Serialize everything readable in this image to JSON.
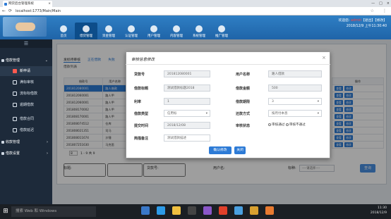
{
  "browser": {
    "tab_title": "网贷后台管理系统",
    "tab_close": "×",
    "url": "localhost:1773/Main/Main",
    "minimize": "—",
    "maximize": "□",
    "close": "×"
  },
  "header": {
    "nav": [
      "首页",
      "借贷管理",
      "资金管理",
      "认证管理",
      "用户管理",
      "内容管理",
      "系统管理",
      "推广管理"
    ],
    "welcome_prefix": "欢迎您: ",
    "user": "admin",
    "welcome_suffix": "【退出】【修改】",
    "datetime": "2018/12/9 上午11:30:40"
  },
  "sidebar": {
    "groups": [
      "借款管理",
      "收款管理",
      "借款设置"
    ],
    "items": [
      "新申请",
      "满标审核",
      "流标标借款",
      "逾期借款",
      "借款合同",
      "借款延迟"
    ]
  },
  "main": {
    "tabs": [
      "发标待审核",
      "正在借款",
      "失败"
    ],
    "list_title": "借款列表",
    "left_headers": [
      "借款号",
      "用户名称"
    ],
    "left_rows": [
      [
        "201812080001",
        "路人借款"
      ],
      [
        "201812060001",
        "路人甲"
      ],
      [
        "201812060001",
        "路人甲"
      ],
      [
        "201808170002",
        "路人甲"
      ],
      [
        "201808170001",
        "路人甲"
      ],
      [
        "201808074512",
        "仓库"
      ],
      [
        "201808021351",
        "司马"
      ],
      [
        "201808011674",
        "沙锤"
      ],
      [
        "201807251630",
        "马克思"
      ]
    ],
    "right_headers": [
      "操作",
      ""
    ],
    "view_label": "查看",
    "edit_label": "修改",
    "pager_size": "8",
    "pager_text": "1 - 9  共 9"
  },
  "search": {
    "title_label": "标题:",
    "loan_no_label": "贷款号:",
    "user_label": "用户名:",
    "type_label": "标种:",
    "type_select": "----请选择----",
    "search_btn": "查询"
  },
  "modal": {
    "title": "审核信息修改",
    "close": "×",
    "loan_no_label": "贷款号",
    "loan_no": "201812080001",
    "user_name_label": "用户名称",
    "user_name": "路人借款",
    "loan_title_label": "借款标题",
    "loan_title": "测试借款标题2018",
    "loan_amount_label": "借款金额",
    "loan_amount": "500",
    "rate_label": "利率",
    "rate": "1",
    "period_label": "借款期限",
    "period": "3",
    "type_label": "借款类型",
    "type": "信用标",
    "repay_label": "还款方式",
    "repay": "按月付本息",
    "submit_time_label": "提交时间",
    "submit_time": "2018/12/08",
    "status_label": "审核状态",
    "pass": "审核通过",
    "fail": "审核不通过",
    "note_label": "简描备注",
    "note": "测试借款描述",
    "save_btn": "确认修改",
    "close_btn": "关闭"
  },
  "taskbar": {
    "search_placeholder": "搜索 Web 和 Windows",
    "time": "11:30",
    "date": "2018/12/9"
  }
}
